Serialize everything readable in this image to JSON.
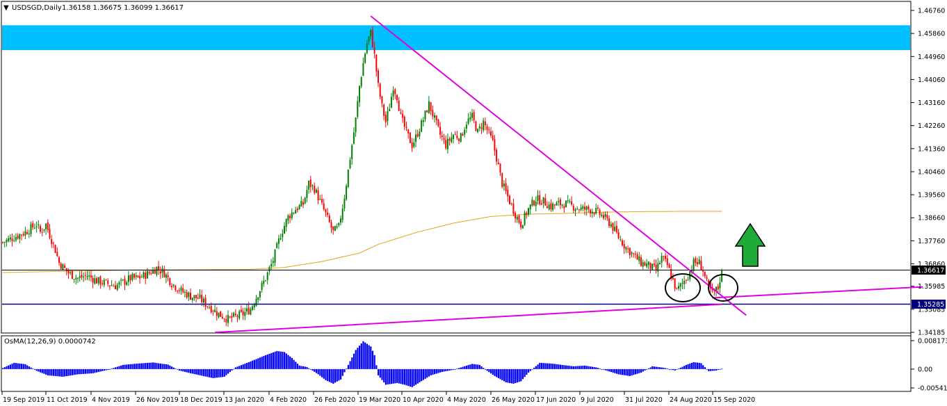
{
  "header": {
    "symbol": "USDSGD,Daily",
    "ohlc": "1.36158 1.36675 1.36099 1.36617"
  },
  "indicator": {
    "label": "OsMA(12,26,9) 0.0000742"
  },
  "colors": {
    "bull": "#008000",
    "bear": "#ff0000",
    "resistance_zone": "#00bfff",
    "trendline": "#e100e1",
    "moving_average": "#e8a317",
    "support_line": "#000080",
    "current_price_line": "#000000",
    "osma_bar": "#0000ff",
    "arrow": "#1faa3a"
  },
  "chart_data": [
    {
      "type": "candlestick",
      "symbol": "USDSGD",
      "timeframe": "Daily",
      "title": "USDSGD,Daily",
      "ylim": [
        1.34185,
        1.4676
      ],
      "y_ticks": [
        "1.46760",
        "1.45860",
        "1.44960",
        "1.44060",
        "1.43160",
        "1.42260",
        "1.41360",
        "1.40460",
        "1.39560",
        "1.38660",
        "1.37760",
        "1.36860",
        "1.35985",
        "1.35085",
        "1.34185"
      ],
      "x_ticks": [
        "19 Sep 2019",
        "11 Oct 2019",
        "4 Nov 2019",
        "26 Nov 2019",
        "18 Dec 2019",
        "13 Jan 2020",
        "4 Feb 2020",
        "26 Feb 2020",
        "19 Mar 2020",
        "10 Apr 2020",
        "4 May 2020",
        "26 May 2020",
        "17 Jun 2020",
        "9 Jul 2020",
        "31 Jul 2020",
        "24 Aug 2020",
        "15 Sep 2020"
      ],
      "current_price": "1.36617",
      "support_level": "1.35285",
      "resistance_zone": [
        1.4521,
        1.4618
      ],
      "close_path": [
        [
          0,
          1.377
        ],
        [
          6,
          1.379
        ],
        [
          12,
          1.381
        ],
        [
          18,
          1.384
        ],
        [
          20,
          1.381
        ],
        [
          23,
          1.384
        ],
        [
          26,
          1.378
        ],
        [
          28,
          1.374
        ],
        [
          30,
          1.369
        ],
        [
          35,
          1.365
        ],
        [
          40,
          1.363
        ],
        [
          45,
          1.364
        ],
        [
          50,
          1.362
        ],
        [
          55,
          1.361
        ],
        [
          60,
          1.36
        ],
        [
          63,
          1.361
        ],
        [
          68,
          1.363
        ],
        [
          72,
          1.363
        ],
        [
          78,
          1.365
        ],
        [
          82,
          1.367
        ],
        [
          86,
          1.365
        ],
        [
          90,
          1.361
        ],
        [
          95,
          1.358
        ],
        [
          100,
          1.356
        ],
        [
          105,
          1.355
        ],
        [
          108,
          1.353
        ],
        [
          110,
          1.352
        ],
        [
          115,
          1.349
        ],
        [
          120,
          1.347
        ],
        [
          124,
          1.348
        ],
        [
          128,
          1.349
        ],
        [
          132,
          1.351
        ],
        [
          136,
          1.357
        ],
        [
          140,
          1.363
        ],
        [
          144,
          1.37
        ],
        [
          148,
          1.38
        ],
        [
          152,
          1.387
        ],
        [
          156,
          1.39
        ],
        [
          160,
          1.392
        ],
        [
          163,
          1.4
        ],
        [
          166,
          1.398
        ],
        [
          169,
          1.393
        ],
        [
          172,
          1.388
        ],
        [
          176,
          1.381
        ],
        [
          179,
          1.383
        ],
        [
          182,
          1.395
        ],
        [
          185,
          1.41
        ],
        [
          188,
          1.425
        ],
        [
          190,
          1.438
        ],
        [
          192,
          1.447
        ],
        [
          194,
          1.455
        ],
        [
          196,
          1.459
        ],
        [
          198,
          1.45
        ],
        [
          200,
          1.438
        ],
        [
          202,
          1.43
        ],
        [
          204,
          1.424
        ],
        [
          206,
          1.43
        ],
        [
          208,
          1.438
        ],
        [
          210,
          1.434
        ],
        [
          212,
          1.426
        ],
        [
          215,
          1.42
        ],
        [
          218,
          1.415
        ],
        [
          220,
          1.418
        ],
        [
          224,
          1.425
        ],
        [
          227,
          1.431
        ],
        [
          230,
          1.425
        ],
        [
          233,
          1.419
        ],
        [
          236,
          1.415
        ],
        [
          240,
          1.419
        ],
        [
          244,
          1.418
        ],
        [
          247,
          1.424
        ],
        [
          250,
          1.426
        ],
        [
          253,
          1.42
        ],
        [
          256,
          1.424
        ],
        [
          258,
          1.421
        ],
        [
          261,
          1.416
        ],
        [
          263,
          1.41
        ],
        [
          266,
          1.4
        ],
        [
          270,
          1.393
        ],
        [
          273,
          1.388
        ],
        [
          276,
          1.384
        ],
        [
          280,
          1.39
        ],
        [
          284,
          1.394
        ],
        [
          288,
          1.393
        ],
        [
          292,
          1.391
        ],
        [
          296,
          1.392
        ],
        [
          300,
          1.392
        ],
        [
          304,
          1.391
        ],
        [
          308,
          1.39
        ],
        [
          312,
          1.39
        ],
        [
          316,
          1.389
        ],
        [
          320,
          1.387
        ],
        [
          324,
          1.384
        ],
        [
          328,
          1.379
        ],
        [
          332,
          1.375
        ],
        [
          336,
          1.372
        ],
        [
          340,
          1.369
        ],
        [
          344,
          1.368
        ],
        [
          348,
          1.366
        ],
        [
          351,
          1.371
        ],
        [
          354,
          1.368
        ],
        [
          357,
          1.362
        ],
        [
          359,
          1.358
        ],
        [
          362,
          1.361
        ],
        [
          365,
          1.364
        ],
        [
          368,
          1.369
        ],
        [
          371,
          1.369
        ],
        [
          373,
          1.366
        ],
        [
          375,
          1.361
        ],
        [
          378,
          1.357
        ],
        [
          381,
          1.359
        ],
        [
          383,
          1.3662
        ]
      ],
      "moving_average": [
        [
          0,
          1.3652
        ],
        [
          40,
          1.3658
        ],
        [
          70,
          1.3662
        ],
        [
          100,
          1.3663
        ],
        [
          130,
          1.3664
        ],
        [
          150,
          1.3672
        ],
        [
          170,
          1.3695
        ],
        [
          190,
          1.3728
        ],
        [
          200,
          1.3762
        ],
        [
          220,
          1.3808
        ],
        [
          240,
          1.3845
        ],
        [
          260,
          1.3871
        ],
        [
          280,
          1.388
        ],
        [
          300,
          1.3883
        ],
        [
          320,
          1.3888
        ],
        [
          340,
          1.389
        ],
        [
          360,
          1.3891
        ],
        [
          383,
          1.3891
        ]
      ],
      "trendlines": [
        {
          "from": [
            196,
            1.4654
          ],
          "to": [
            396,
            1.3485
          ]
        },
        {
          "from": [
            113,
            1.3418
          ],
          "to": [
            383,
            1.3528
          ]
        },
        {
          "from": [
            378,
            1.3553
          ],
          "to": [
            490,
            1.3596
          ]
        }
      ],
      "annotations": [
        "ellipse near 24 Aug 2020 lows",
        "ellipse near 15 Sep 2020 lows",
        "green up arrow"
      ]
    },
    {
      "type": "bar",
      "name": "OsMA(12,26,9)",
      "value": "0.0000742",
      "ylim": [
        -0.00541,
        0.0081735
      ],
      "y_ticks": [
        "0.0081735",
        "0.00",
        "-0.005410"
      ],
      "histogram_path": [
        [
          0,
          0.0003
        ],
        [
          6,
          0.0018
        ],
        [
          12,
          0.0014
        ],
        [
          18,
          -0.0005
        ],
        [
          24,
          -0.0018
        ],
        [
          32,
          -0.0022
        ],
        [
          40,
          -0.0015
        ],
        [
          48,
          -0.0012
        ],
        [
          56,
          -0.0002
        ],
        [
          64,
          0.0012
        ],
        [
          72,
          0.0016
        ],
        [
          80,
          0.0019
        ],
        [
          88,
          0.0013
        ],
        [
          94,
          -0.0004
        ],
        [
          100,
          -0.0012
        ],
        [
          106,
          -0.0019
        ],
        [
          112,
          -0.0026
        ],
        [
          118,
          -0.0022
        ],
        [
          124,
          0.0005
        ],
        [
          132,
          0.0022
        ],
        [
          140,
          0.004
        ],
        [
          146,
          0.0052
        ],
        [
          150,
          0.0049
        ],
        [
          154,
          0.0032
        ],
        [
          158,
          0.001
        ],
        [
          162,
          0.0006
        ],
        [
          168,
          -0.0015
        ],
        [
          172,
          -0.0032
        ],
        [
          176,
          -0.0042
        ],
        [
          180,
          -0.003
        ],
        [
          184,
          0.0012
        ],
        [
          188,
          0.0055
        ],
        [
          192,
          0.008
        ],
        [
          196,
          0.0065
        ],
        [
          198,
          0.004
        ],
        [
          200,
          -0.0018
        ],
        [
          204,
          -0.0045
        ],
        [
          210,
          -0.004
        ],
        [
          214,
          -0.0045
        ],
        [
          218,
          -0.0052
        ],
        [
          222,
          -0.0038
        ],
        [
          228,
          -0.0018
        ],
        [
          234,
          -0.0008
        ],
        [
          240,
          -0.0002
        ],
        [
          250,
          0.0015
        ],
        [
          254,
          0.0012
        ],
        [
          258,
          -0.0005
        ],
        [
          262,
          -0.002
        ],
        [
          268,
          -0.0038
        ],
        [
          272,
          -0.0042
        ],
        [
          276,
          -0.0035
        ],
        [
          280,
          -0.001
        ],
        [
          286,
          0.0018
        ],
        [
          292,
          0.0016
        ],
        [
          298,
          0.0012
        ],
        [
          304,
          0.0008
        ],
        [
          310,
          0.001
        ],
        [
          316,
          0.0005
        ],
        [
          322,
          -0.0005
        ],
        [
          328,
          -0.0015
        ],
        [
          334,
          -0.002
        ],
        [
          340,
          -0.001
        ],
        [
          346,
          0.0008
        ],
        [
          352,
          0.0004
        ],
        [
          358,
          -0.0004
        ],
        [
          364,
          0.0012
        ],
        [
          368,
          0.002
        ],
        [
          372,
          0.0017
        ],
        [
          376,
          -0.0006
        ],
        [
          380,
          -0.0004
        ],
        [
          383,
          0.0001
        ]
      ]
    }
  ]
}
